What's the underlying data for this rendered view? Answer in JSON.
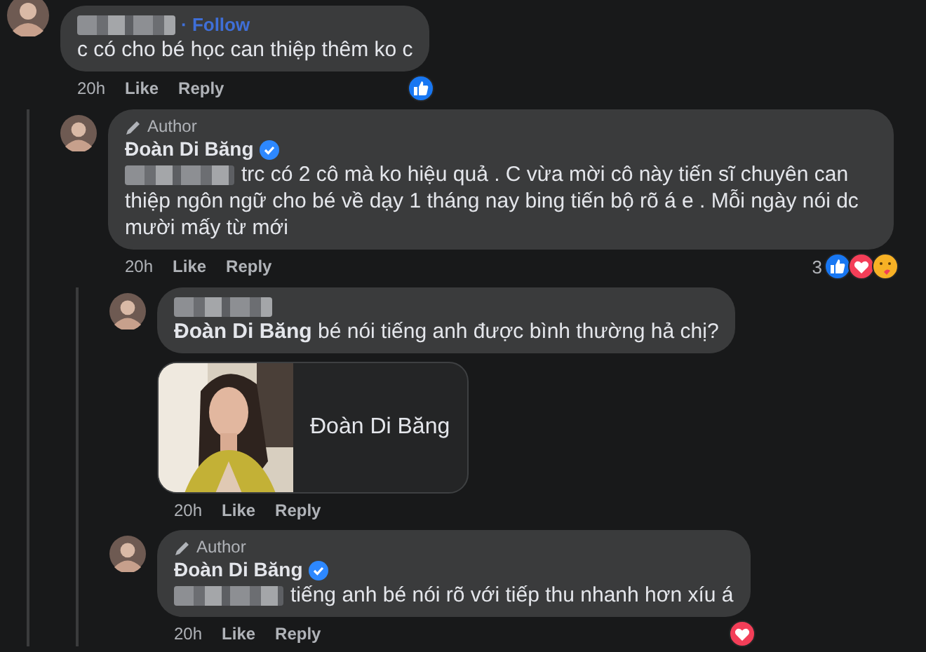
{
  "comments": [
    {
      "header": {
        "kind": "redacted",
        "follow": "· Follow"
      },
      "body": {
        "text": "c có cho bé học can thiệp thêm ko c"
      },
      "time": "20h",
      "actions": [
        "Like",
        "Reply"
      ],
      "reactions": {
        "icons": [
          {
            "kind": "like"
          }
        ]
      },
      "children": [
        {
          "header": {
            "kind": "named",
            "name": "Đoàn Di Băng",
            "verified": true
          },
          "author_badge": "Author",
          "body": {
            "redacted": true,
            "text": "trc có 2 cô mà ko hiệu quả . C vừa mời cô này tiến sĩ chuyên can thiệp ngôn ngữ cho bé về dạy 1 tháng nay bing tiến bộ rõ á e . Mỗi ngày nói dc mười mấy từ mới"
          },
          "time": "20h",
          "actions": [
            "Like",
            "Reply"
          ],
          "reactions": {
            "count": "3",
            "icons": [
              {
                "kind": "like"
              },
              {
                "kind": "love"
              },
              {
                "kind": "care"
              }
            ]
          },
          "children": [
            {
              "header": {
                "kind": "redacted"
              },
              "body": {
                "text": "**Đoàn Di Băng** bé nói tiếng anh được bình thường hả chị?"
              },
              "attachment": {
                "kind": "picture",
                "title": "Đoàn Di Băng"
              },
              "time": "20h",
              "actions": [
                "Like",
                "Reply"
              ]
            },
            {
              "header": {
                "kind": "named",
                "name": "Đoàn Di Băng",
                "verified": true
              },
              "author_badge": "Author",
              "body": {
                "redacted": true,
                "text": "tiếng anh bé nói rõ với tiếp thu nhanh hơn xíu á"
              },
              "time": "20h",
              "actions": [
                "Like",
                "Reply"
              ],
              "reactions": {
                "icons": [
                  {
                    "kind": "love"
                  }
                ]
              }
            }
          ]
        }
      ]
    }
  ]
}
